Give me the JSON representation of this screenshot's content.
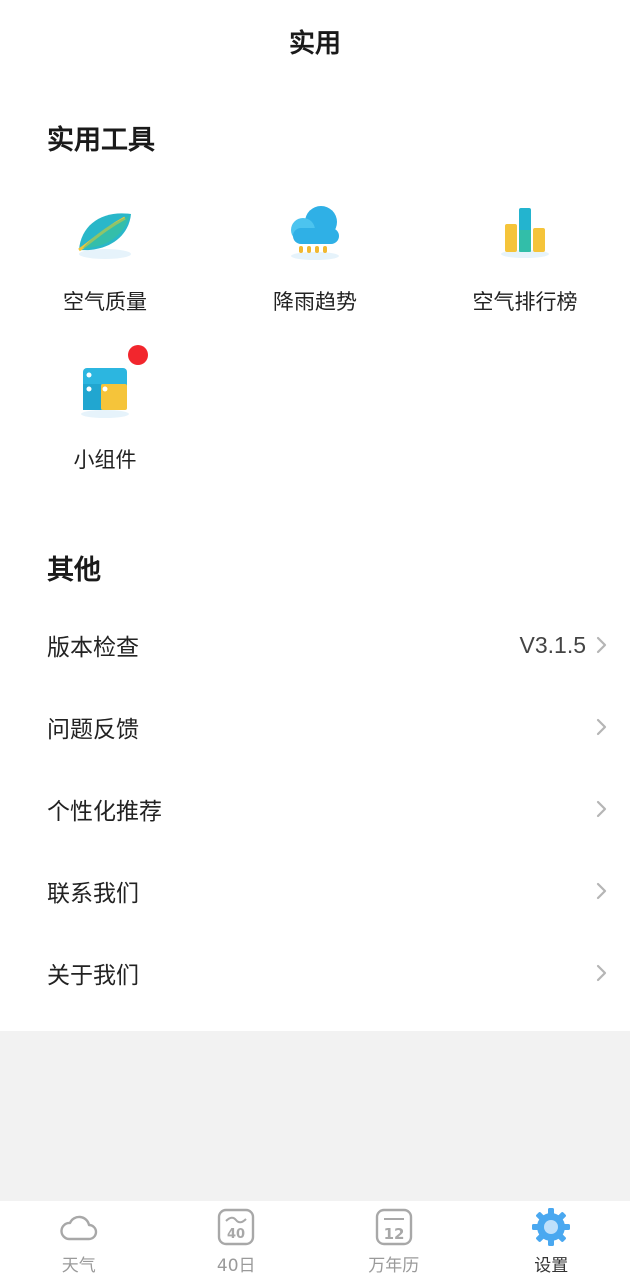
{
  "header": {
    "title": "实用"
  },
  "tools_section": {
    "title": "实用工具",
    "items": [
      {
        "label": "空气质量",
        "icon": "leaf-icon"
      },
      {
        "label": "降雨趋势",
        "icon": "rain-cloud-icon"
      },
      {
        "label": "空气排行榜",
        "icon": "bar-ranking-icon"
      },
      {
        "label": "小组件",
        "icon": "widget-icon",
        "has_badge": true
      }
    ]
  },
  "other_section": {
    "title": "其他",
    "items": [
      {
        "label": "版本检查",
        "value": "V3.1.5"
      },
      {
        "label": "问题反馈",
        "value": ""
      },
      {
        "label": "个性化推荐",
        "value": ""
      },
      {
        "label": "联系我们",
        "value": ""
      },
      {
        "label": "关于我们",
        "value": ""
      }
    ]
  },
  "tabbar": {
    "items": [
      {
        "label": "天气",
        "icon": "cloud-icon",
        "active": false
      },
      {
        "label": "40日",
        "icon": "calendar-40-icon",
        "active": false
      },
      {
        "label": "万年历",
        "icon": "calendar-12-icon",
        "active": false
      },
      {
        "label": "设置",
        "icon": "gear-icon",
        "active": true
      }
    ]
  },
  "colors": {
    "accent": "#4aa8f0",
    "badge": "#f2262d",
    "inactive_tab": "#9a9a9a"
  }
}
